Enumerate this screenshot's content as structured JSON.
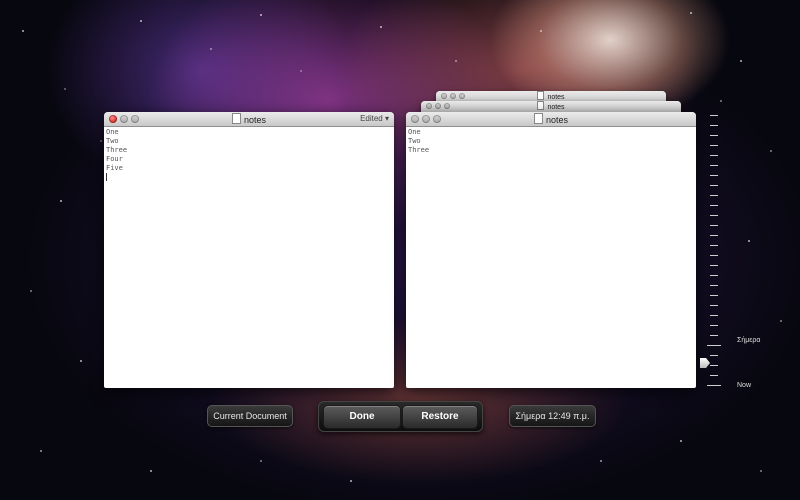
{
  "front_window": {
    "title": "notes",
    "status": "Edited",
    "lines": [
      "One",
      "Two",
      "Three",
      "Four",
      "Five"
    ]
  },
  "back_windows": [
    {
      "title": "notes"
    },
    {
      "title": "notes"
    }
  ],
  "snapshot_window": {
    "title": "notes",
    "lines": [
      "One",
      "Two",
      "Three"
    ]
  },
  "timeline": {
    "label_today": "Σήμερα",
    "label_now": "Now"
  },
  "controls": {
    "current_document_label": "Current Document",
    "done_label": "Done",
    "restore_label": "Restore",
    "snapshot_time": "Σήμερα 12:49 π.μ."
  },
  "colors": {
    "close_red": "#d02a23",
    "button_dark": "#2a2a2a"
  }
}
